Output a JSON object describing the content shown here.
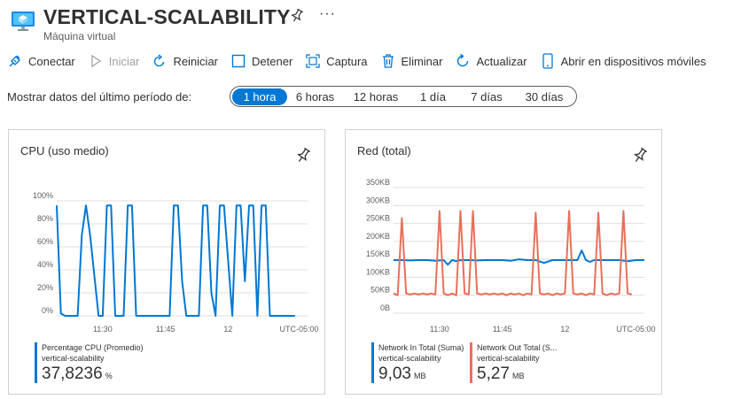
{
  "header": {
    "title": "VERTICAL-SCALABILITY",
    "subtitle": "Máquina virtual",
    "icon": "virtual-machine-icon",
    "pin_icon": "pin-icon",
    "more_label": "···"
  },
  "toolbar": {
    "connect": {
      "label": "Conectar",
      "icon": "plug-icon"
    },
    "start": {
      "label": "Iniciar",
      "icon": "play-icon"
    },
    "restart": {
      "label": "Reiniciar",
      "icon": "restart-icon"
    },
    "stop": {
      "label": "Detener",
      "icon": "stop-icon"
    },
    "capture": {
      "label": "Captura",
      "icon": "capture-icon"
    },
    "delete": {
      "label": "Eliminar",
      "icon": "trash-icon"
    },
    "refresh": {
      "label": "Actualizar",
      "icon": "refresh-icon"
    },
    "mobile": {
      "label": "Abrir en dispositivos móviles",
      "icon": "mobile-icon"
    }
  },
  "period": {
    "label": "Mostrar datos del último período de:",
    "options": [
      "1 hora",
      "6 horas",
      "12 horas",
      "1 día",
      "7 días",
      "30 días"
    ],
    "selected": "1 hora"
  },
  "colors": {
    "accent": "#0078d4",
    "network_out": "#e8705b",
    "grid": "#e1dfdd"
  },
  "cards": {
    "cpu": {
      "title": "CPU (uso medio)",
      "legend": {
        "name": "Percentage CPU (Promedio)",
        "resource": "vertical-scalability",
        "value": "37,8236",
        "unit": "%"
      }
    },
    "network": {
      "title": "Red (total)",
      "legend_in": {
        "name": "Network In Total (Suma)",
        "resource": "vertical-scalability",
        "value": "9,03",
        "unit": "MB"
      },
      "legend_out": {
        "name": "Network Out Total (S...",
        "resource": "vertical-scalability",
        "value": "5,27",
        "unit": "MB"
      }
    }
  },
  "chart_data": [
    {
      "type": "line",
      "y_ticks": [
        "100%",
        "80%",
        "60%",
        "40%",
        "20%",
        "0%"
      ],
      "ylim": [
        0,
        100
      ],
      "x_ticks": [
        {
          "label": "11:30",
          "at": 11
        },
        {
          "label": "11:45",
          "at": 26
        },
        {
          "label": "12",
          "at": 41
        },
        {
          "label": "UTC-05:00",
          "at": 58
        }
      ],
      "xlim": [
        0,
        60
      ],
      "series": [
        {
          "name": "Percentage CPU (Promedio)",
          "color": "#0078d4",
          "x": [
            0,
            1,
            2,
            5,
            6,
            7,
            8,
            10,
            11,
            12,
            13,
            14,
            16,
            17,
            18,
            19,
            22,
            27,
            28,
            29,
            30,
            31,
            33,
            34,
            35,
            36,
            37,
            38,
            39,
            40,
            42,
            43,
            44,
            45,
            46,
            47,
            48,
            49,
            50,
            51,
            52,
            53,
            54,
            56,
            57
          ],
          "y": [
            96,
            2,
            0,
            0,
            70,
            96,
            70,
            0,
            0,
            96,
            96,
            0,
            0,
            96,
            96,
            0,
            0,
            0,
            96,
            96,
            30,
            0,
            0,
            0,
            96,
            96,
            20,
            0,
            96,
            96,
            0,
            96,
            96,
            30,
            96,
            96,
            0,
            96,
            96,
            0,
            0,
            0,
            0,
            0,
            0
          ]
        }
      ]
    },
    {
      "type": "line",
      "y_ticks": [
        "350KB",
        "300KB",
        "250KB",
        "200KB",
        "150KB",
        "100KB",
        "50KB",
        "0B"
      ],
      "ylim": [
        0,
        350
      ],
      "x_ticks": [
        {
          "label": "11:30",
          "at": 11
        },
        {
          "label": "11:45",
          "at": 26
        },
        {
          "label": "12",
          "at": 41
        },
        {
          "label": "UTC-05:00",
          "at": 58
        }
      ],
      "xlim": [
        0,
        60
      ],
      "series": [
        {
          "name": "Network In Total (Suma)",
          "color": "#0078d4",
          "x": [
            0,
            2,
            4,
            6,
            8,
            10,
            12,
            13,
            14,
            15,
            16,
            18,
            20,
            22,
            24,
            26,
            28,
            30,
            32,
            34,
            36,
            38,
            40,
            42,
            44,
            45,
            46,
            47,
            48,
            50,
            52,
            54,
            56,
            58,
            60
          ],
          "y": [
            148,
            148,
            147,
            148,
            148,
            146,
            148,
            135,
            148,
            145,
            148,
            148,
            147,
            148,
            148,
            148,
            146,
            150,
            148,
            148,
            140,
            148,
            148,
            148,
            148,
            175,
            148,
            143,
            148,
            148,
            148,
            148,
            145,
            148,
            148
          ]
        },
        {
          "name": "Network Out Total (S...",
          "color": "#e8705b",
          "x": [
            0,
            1,
            2,
            3,
            4,
            5,
            6,
            7,
            8,
            9,
            10,
            11,
            12,
            13,
            14,
            15,
            16,
            17,
            18,
            19,
            20,
            21,
            22,
            23,
            24,
            25,
            26,
            27,
            28,
            29,
            30,
            31,
            32,
            33,
            34,
            35,
            36,
            37,
            38,
            39,
            40,
            41,
            42,
            43,
            44,
            45,
            46,
            47,
            48,
            49,
            50,
            51,
            52,
            53,
            54,
            55,
            56,
            57
          ],
          "y": [
            55,
            50,
            265,
            55,
            52,
            55,
            52,
            55,
            52,
            55,
            52,
            285,
            55,
            50,
            55,
            50,
            285,
            55,
            52,
            285,
            55,
            52,
            55,
            52,
            55,
            52,
            55,
            50,
            55,
            52,
            55,
            50,
            55,
            52,
            280,
            55,
            52,
            55,
            50,
            55,
            52,
            55,
            285,
            55,
            52,
            55,
            50,
            55,
            52,
            280,
            55,
            50,
            55,
            52,
            55,
            285,
            55,
            52
          ]
        }
      ]
    }
  ]
}
